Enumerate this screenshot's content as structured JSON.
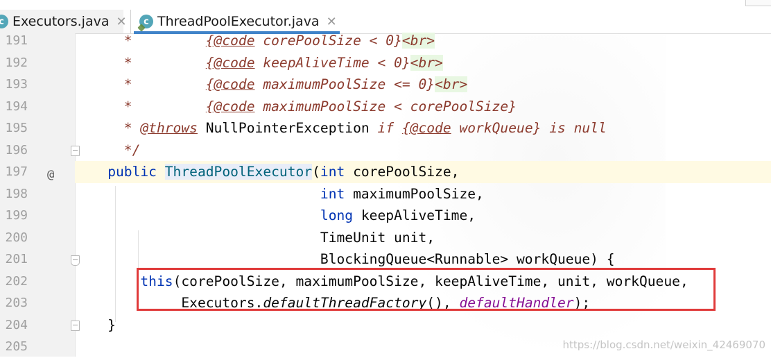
{
  "tabs": [
    {
      "icon": "c",
      "label": "Executors.java",
      "close": "✕",
      "active": false
    },
    {
      "icon": "c",
      "label": "ThreadPoolExecutor.java",
      "close": "✕",
      "active": true
    }
  ],
  "gutter_marks": {
    "override": "@"
  },
  "lines": [
    {
      "num": "191",
      "tokens": [
        [
          "doc",
          "      *         "
        ],
        [
          "tag",
          "{@code"
        ],
        [
          "doc",
          " corePoolSize < 0}"
        ],
        [
          "html-tag",
          "<br>"
        ]
      ]
    },
    {
      "num": "192",
      "tokens": [
        [
          "doc",
          "      *         "
        ],
        [
          "tag",
          "{@code"
        ],
        [
          "doc",
          " keepAliveTime < 0}"
        ],
        [
          "html-tag",
          "<br>"
        ]
      ]
    },
    {
      "num": "193",
      "tokens": [
        [
          "doc",
          "      *         "
        ],
        [
          "tag",
          "{@code"
        ],
        [
          "doc",
          " maximumPoolSize <= 0}"
        ],
        [
          "html-tag",
          "<br>"
        ]
      ]
    },
    {
      "num": "194",
      "tokens": [
        [
          "doc",
          "      *         "
        ],
        [
          "tag",
          "{@code"
        ],
        [
          "doc",
          " maximumPoolSize < corePoolSize}"
        ]
      ]
    },
    {
      "num": "195",
      "tokens": [
        [
          "doc",
          "      * "
        ],
        [
          "tag",
          "@throws"
        ],
        [
          "doc",
          " "
        ],
        [
          "plain",
          "NullPointerException"
        ],
        [
          "doc",
          " if "
        ],
        [
          "tag",
          "{@code"
        ],
        [
          "doc",
          " workQueue} is null"
        ]
      ]
    },
    {
      "num": "196",
      "tokens": [
        [
          "doc",
          "      */"
        ]
      ]
    },
    {
      "num": "197",
      "tokens": [
        [
          "plain",
          "    "
        ],
        [
          "kw",
          "public"
        ],
        [
          "plain",
          " "
        ],
        [
          "decl",
          "ThreadPoolExecutor"
        ],
        [
          "plain",
          "("
        ],
        [
          "kw",
          "int"
        ],
        [
          "plain",
          " corePoolSize,"
        ]
      ]
    },
    {
      "num": "198",
      "tokens": [
        [
          "plain",
          "                              "
        ],
        [
          "kw",
          "int"
        ],
        [
          "plain",
          " maximumPoolSize,"
        ]
      ]
    },
    {
      "num": "199",
      "tokens": [
        [
          "plain",
          "                              "
        ],
        [
          "kw",
          "long"
        ],
        [
          "plain",
          " keepAliveTime,"
        ]
      ]
    },
    {
      "num": "200",
      "tokens": [
        [
          "plain",
          "                              TimeUnit unit,"
        ]
      ]
    },
    {
      "num": "201",
      "tokens": [
        [
          "plain",
          "                              BlockingQueue<Runnable> workQueue) {"
        ]
      ]
    },
    {
      "num": "202",
      "tokens": [
        [
          "plain",
          "        "
        ],
        [
          "kw",
          "this"
        ],
        [
          "plain",
          "(corePoolSize, maximumPoolSize, keepAliveTime, unit, workQueue,"
        ]
      ]
    },
    {
      "num": "203",
      "tokens": [
        [
          "plain",
          "             Executors."
        ],
        [
          "static",
          "defaultThreadFactory"
        ],
        [
          "plain",
          "(), "
        ],
        [
          "field",
          "defaultHandler"
        ],
        [
          "plain",
          ");"
        ]
      ]
    },
    {
      "num": "204",
      "tokens": [
        [
          "plain",
          "    }"
        ]
      ]
    },
    {
      "num": "205",
      "tokens": []
    }
  ],
  "watermark": "https://blog.csdn.net/weixin_42469070"
}
